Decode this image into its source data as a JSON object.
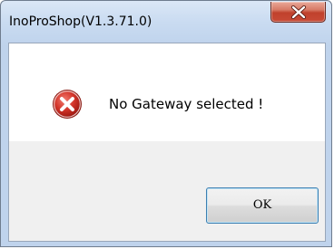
{
  "window": {
    "title": "InoProShop(V1.3.71.0)"
  },
  "dialog": {
    "message": "No Gateway selected !",
    "icon": "error-icon"
  },
  "buttons": {
    "ok_label": "OK",
    "close_icon": "close-icon"
  },
  "colors": {
    "title_bar": "#c9dbf1",
    "close_button": "#c84a36",
    "error_icon": "#c8281e",
    "content_bg": "#ffffff",
    "footer_bg": "#f0f0f0"
  }
}
